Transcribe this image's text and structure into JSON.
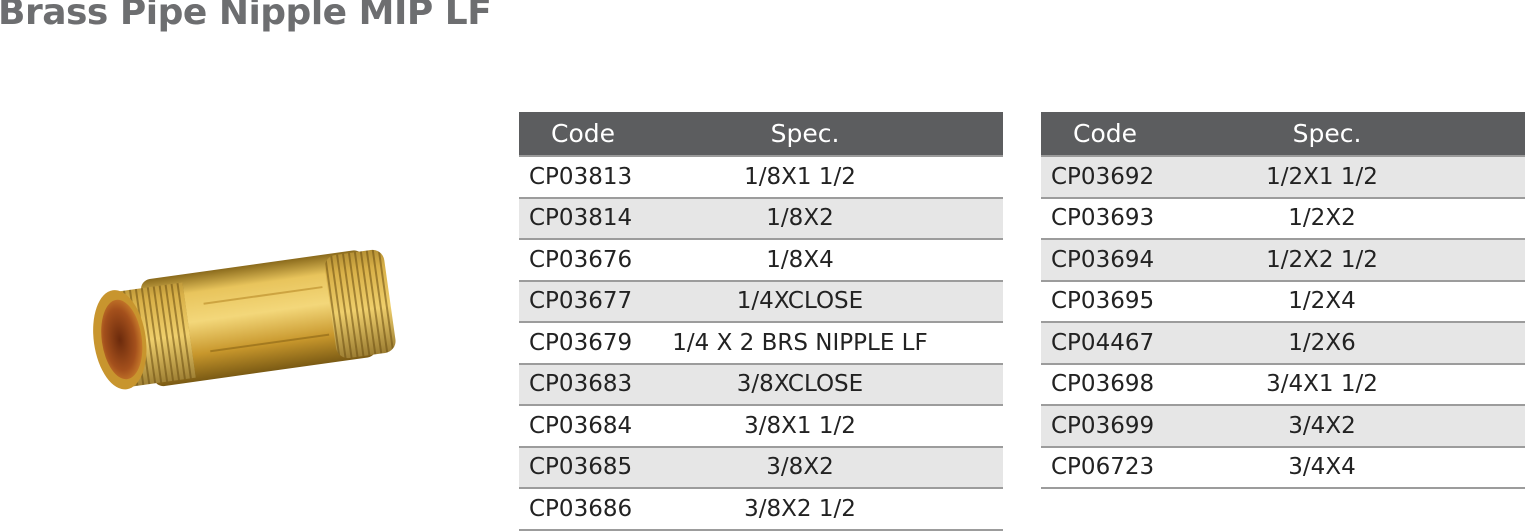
{
  "title": "Brass Pipe Nipple MIP LF",
  "image": {
    "alt": "brass pipe nipple photo"
  },
  "tables": {
    "left": {
      "headers": [
        "Code",
        "Spec."
      ],
      "rows": [
        {
          "code": "CP03813",
          "spec": "1/8X1 1/2"
        },
        {
          "code": "CP03814",
          "spec": "1/8X2"
        },
        {
          "code": "CP03676",
          "spec": "1/8X4"
        },
        {
          "code": "CP03677",
          "spec": "1/4XCLOSE"
        },
        {
          "code": "CP03679",
          "spec": "1/4 X 2 BRS NIPPLE LF"
        },
        {
          "code": "CP03683",
          "spec": "3/8XCLOSE"
        },
        {
          "code": "CP03684",
          "spec": "3/8X1 1/2"
        },
        {
          "code": "CP03685",
          "spec": "3/8X2"
        },
        {
          "code": "CP03686",
          "spec": "3/8X2 1/2"
        }
      ]
    },
    "right": {
      "headers": [
        "Code",
        "Spec."
      ],
      "rows": [
        {
          "code": "CP03692",
          "spec": "1/2X1 1/2"
        },
        {
          "code": "CP03693",
          "spec": "1/2X2"
        },
        {
          "code": "CP03694",
          "spec": "1/2X2 1/2"
        },
        {
          "code": "CP03695",
          "spec": "1/2X4"
        },
        {
          "code": "CP04467",
          "spec": "1/2X6"
        },
        {
          "code": "CP03698",
          "spec": "3/4X1 1/2"
        },
        {
          "code": "CP03699",
          "spec": "3/4X2"
        },
        {
          "code": "CP06723",
          "spec": "3/4X4"
        }
      ]
    }
  },
  "colors": {
    "title": "#6d6e70",
    "header_bg": "#5c5d5f",
    "row_shade": "#e6e6e6",
    "brass": "#d4a93a"
  }
}
